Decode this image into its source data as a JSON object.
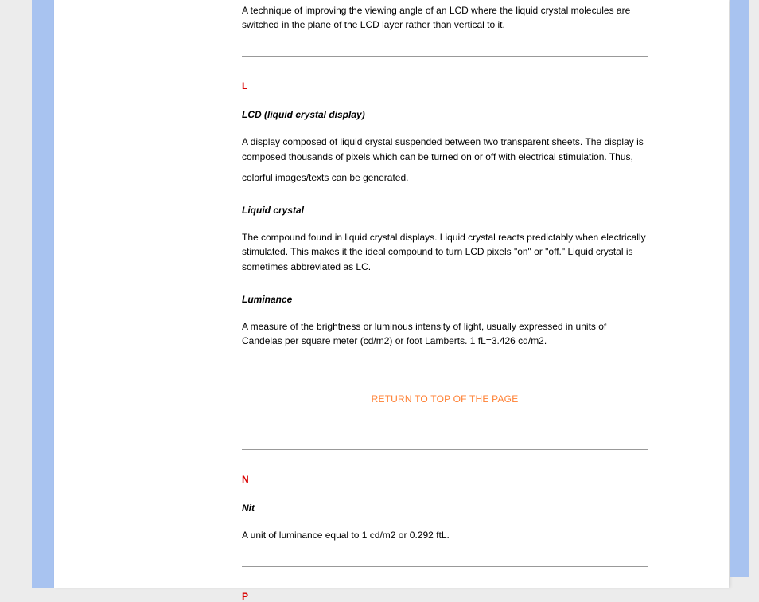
{
  "intro_paragraph": "A technique of improving the viewing angle of an LCD where the liquid crystal molecules are switched in the plane of the LCD layer rather than vertical to it.",
  "sections": {
    "L": {
      "letter": "L",
      "terms": [
        {
          "term": "LCD (liquid crystal display)",
          "definition": "A display composed of liquid crystal suspended between two transparent sheets. The display is composed thousands of pixels which can be turned on or off with electrical stimulation. Thus,",
          "definition_extra": "colorful images/texts can be generated."
        },
        {
          "term": "Liquid crystal",
          "definition": "The compound found in liquid crystal displays. Liquid crystal reacts predictably when electrically stimulated. This makes it the ideal compound to turn LCD pixels \"on\" or \"off.\" Liquid crystal is sometimes abbreviated as LC."
        },
        {
          "term": "Luminance",
          "definition": "A measure of the brightness or luminous intensity of light, usually expressed in units of Candelas per square meter (cd/m2) or foot Lamberts. 1 fL=3.426 cd/m2."
        }
      ]
    },
    "N": {
      "letter": "N",
      "terms": [
        {
          "term": "Nit",
          "definition": "A unit of luminance equal to 1 cd/m2 or 0.292 ftL."
        }
      ]
    },
    "P": {
      "letter": "P"
    }
  },
  "return_link_label": "RETURN TO TOP OF THE PAGE",
  "colors": {
    "letter_heading": "#d90000",
    "link": "#ff7f32",
    "page_bg": "#ececec",
    "blue_bar": "#a8c3f0"
  }
}
